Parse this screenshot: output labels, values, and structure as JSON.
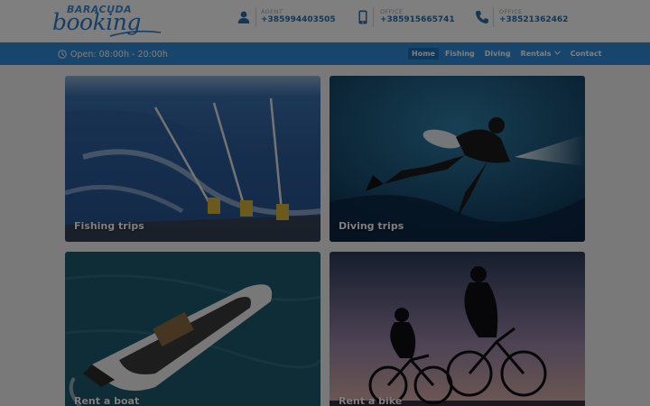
{
  "logo": {
    "top": "BARACUDA",
    "bottom": "booking"
  },
  "contacts": [
    {
      "icon": "user-icon",
      "label": "AGENT",
      "value": "+385994403505"
    },
    {
      "icon": "mobile-icon",
      "label": "OFFICE",
      "value": "+385915665741"
    },
    {
      "icon": "phone-icon",
      "label": "OFFICE",
      "value": "+38521362462"
    }
  ],
  "navbar": {
    "hours": "Open: 08:00h - 20:00h",
    "items": [
      {
        "label": "Home",
        "active": true
      },
      {
        "label": "Fishing"
      },
      {
        "label": "Diving"
      },
      {
        "label": "Rentals",
        "dropdown": true
      },
      {
        "label": "Contact"
      }
    ]
  },
  "cards": [
    {
      "title": "Fishing trips"
    },
    {
      "title": "Diving trips"
    },
    {
      "title": "Rent a boat"
    },
    {
      "title": "Rent a bike"
    }
  ],
  "colors": {
    "brand": "#2e8ad8",
    "accent": "#2a6ea8",
    "background": "#f3f3f3"
  }
}
